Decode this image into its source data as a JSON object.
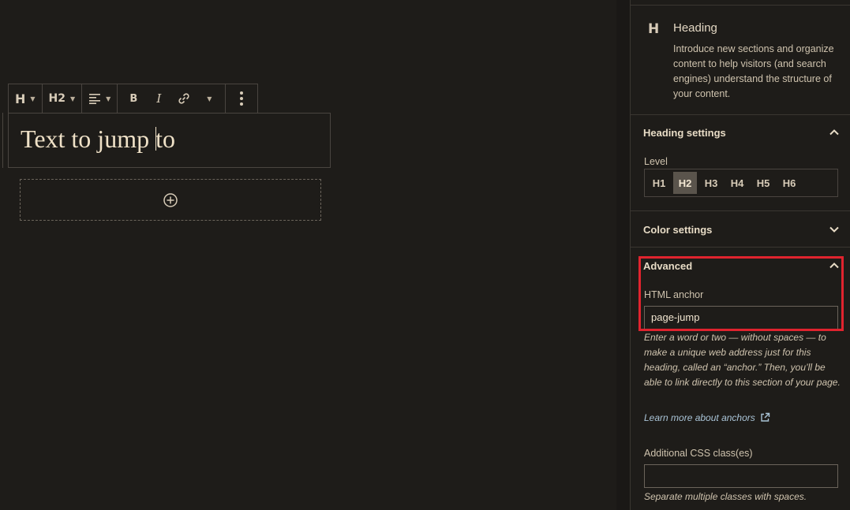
{
  "toolbar": {
    "block_type_icon": "heading-icon",
    "block_type_label": "H",
    "level_label": "H2",
    "align_icon": "align-left-icon",
    "bold_label": "B",
    "italic_label": "I",
    "link_icon": "link-icon",
    "more_rich_icon": "chevron-down-icon",
    "options_icon": "vertical-ellipsis-icon"
  },
  "editor": {
    "heading_text_before_caret": "Text to jump ",
    "heading_text_after_caret": "to",
    "add_block_icon": "plus-circle-icon"
  },
  "sidebar": {
    "block_card": {
      "icon_label": "H",
      "title": "Heading",
      "description": "Introduce new sections and organize content to help visitors (and search engines) understand the structure of your content."
    },
    "heading_settings": {
      "title": "Heading settings",
      "level_label": "Level",
      "levels": [
        "H1",
        "H2",
        "H3",
        "H4",
        "H5",
        "H6"
      ],
      "active_level": "H2"
    },
    "color_settings": {
      "title": "Color settings"
    },
    "advanced": {
      "title": "Advanced",
      "anchor_label": "HTML anchor",
      "anchor_value": "page-jump",
      "anchor_help": "Enter a word or two — without spaces — to make a unique web address just for this heading, called an “anchor.” Then, you’ll be able to link directly to this section of your page.",
      "learn_more": "Learn more about anchors",
      "css_label": "Additional CSS class(es)",
      "css_value": "",
      "css_help": "Separate multiple classes with spaces."
    }
  },
  "colors": {
    "highlight": "#e0232e",
    "background": "#1e1c19",
    "link": "#a9c3d6"
  }
}
